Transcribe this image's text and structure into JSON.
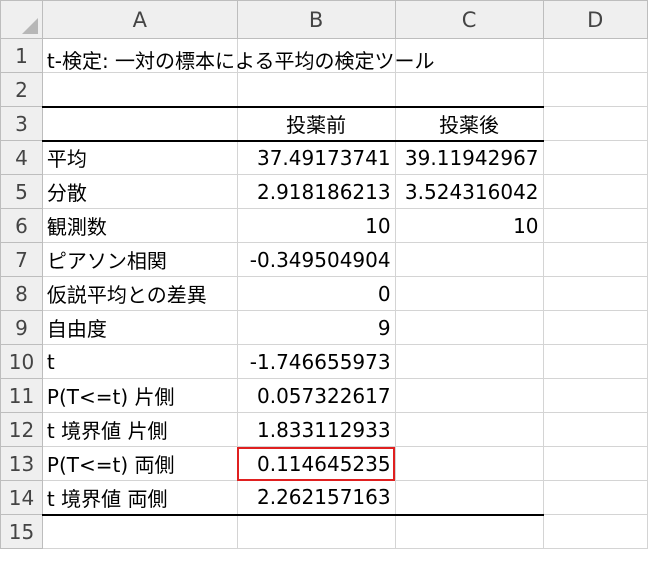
{
  "columns": [
    "A",
    "B",
    "C",
    "D"
  ],
  "rows": [
    "1",
    "2",
    "3",
    "4",
    "5",
    "6",
    "7",
    "8",
    "9",
    "10",
    "11",
    "12",
    "13",
    "14",
    "15"
  ],
  "title": "t-検定: 一対の標本による平均の検定ツール",
  "headers": {
    "b": "投薬前",
    "c": "投薬後"
  },
  "data": [
    {
      "label": "平均",
      "b": "37.49173741",
      "c": "39.11942967"
    },
    {
      "label": "分散",
      "b": "2.918186213",
      "c": "3.524316042"
    },
    {
      "label": "観測数",
      "b": "10",
      "c": "10"
    },
    {
      "label": "ピアソン相関",
      "b": "-0.349504904",
      "c": ""
    },
    {
      "label": "仮説平均との差異",
      "b": "0",
      "c": ""
    },
    {
      "label": "自由度",
      "b": "9",
      "c": ""
    },
    {
      "label": "t",
      "b": "-1.746655973",
      "c": ""
    },
    {
      "label": "P(T<=t) 片側",
      "b": "0.057322617",
      "c": ""
    },
    {
      "label": "t 境界値 片側",
      "b": "1.833112933",
      "c": ""
    },
    {
      "label": "P(T<=t) 両側",
      "b": "0.114645235",
      "c": ""
    },
    {
      "label": "t 境界値 両側",
      "b": "2.262157163",
      "c": ""
    }
  ],
  "colors": {
    "highlight": "#e02020",
    "header_bg": "#efefef"
  }
}
